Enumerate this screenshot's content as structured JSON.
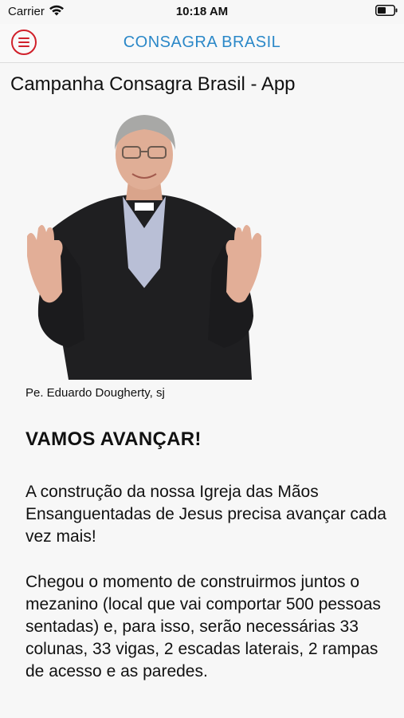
{
  "status_bar": {
    "carrier": "Carrier",
    "time": "10:18 AM",
    "wifi_icon": "wifi-icon",
    "battery_icon": "battery-icon"
  },
  "navbar": {
    "menu_icon": "hamburger-menu-icon",
    "title": "CONSAGRA BRASIL",
    "accent_red": "#d0202a",
    "title_blue": "#2b88c8"
  },
  "page": {
    "heading": "Campanha Consagra Brasil - App",
    "photo_caption": "Pe. Eduardo Dougherty, sj",
    "title": "VAMOS AVANÇAR!",
    "paragraphs": [
      "A construção da nossa Igreja das Mãos Ensanguentadas de Jesus precisa avançar cada vez mais!",
      "Chegou o momento de construirmos juntos o mezanino (local que vai comportar 500 pessoas sentadas) e, para isso, serão necessárias 33 colunas, 33 vigas, 2 escadas laterais, 2 rampas de acesso e as paredes."
    ]
  }
}
